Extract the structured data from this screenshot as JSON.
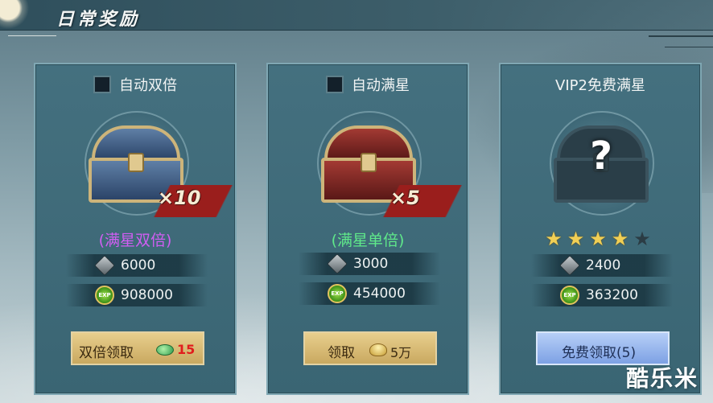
{
  "header": {
    "title": "日常奖励"
  },
  "cards": [
    {
      "title": "自动双倍",
      "multiplier": "×10",
      "tag": "(满星双倍)",
      "tag_color": "#d05ef2",
      "ore": "6000",
      "exp": "908000",
      "button": {
        "label": "双倍领取",
        "cost": "15"
      }
    },
    {
      "title": "自动满星",
      "multiplier": "×5",
      "tag": "(满星单倍)",
      "tag_color": "#5fe88a",
      "ore": "3000",
      "exp": "454000",
      "button": {
        "label": "领取",
        "cost": "5万"
      }
    },
    {
      "title": "VIP2免费满星",
      "stars": {
        "filled": 4,
        "total": 5
      },
      "chest_label": "?",
      "ore": "2400",
      "exp": "363200",
      "button": {
        "label": "免费领取(5)"
      }
    }
  ],
  "exp_icon_text": "EXP",
  "icons": [
    "ore-icon",
    "exp-icon",
    "green-gem-icon",
    "gold-ingot-icon",
    "star-icon",
    "chest-icon"
  ],
  "watermark": "酷乐米"
}
